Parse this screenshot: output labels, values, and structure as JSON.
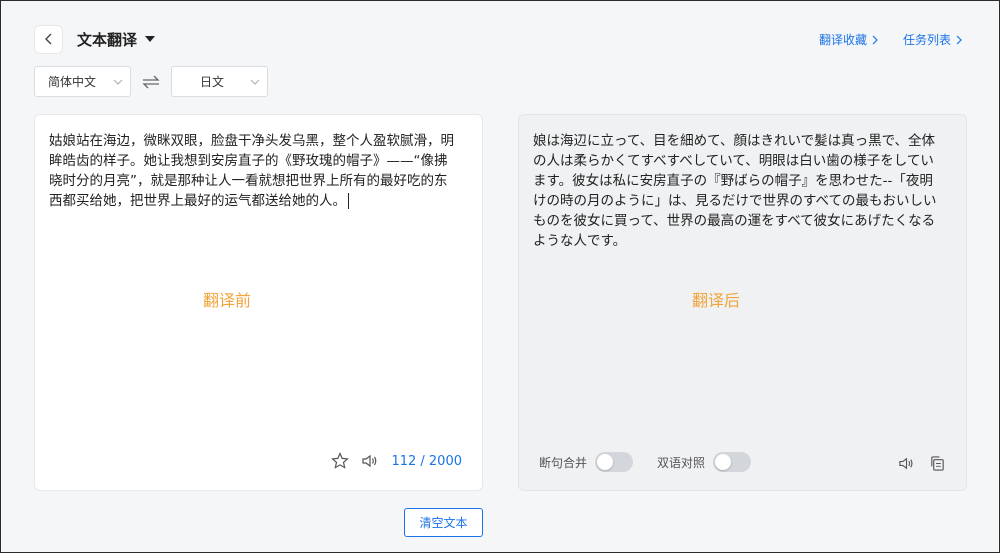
{
  "header": {
    "title": "文本翻译"
  },
  "top_links": {
    "favorites": "翻译收藏",
    "tasks": "任务列表"
  },
  "languages": {
    "source": "简体中文",
    "target": "日文"
  },
  "source_panel": {
    "text": "姑娘站在海边，微眯双眼，脸盘干净头发乌黑，整个人盈软腻滑，明眸皓齿的样子。她让我想到安房直子的《野玫瑰的帽子》——“像拂晓时分的月亮”，就是那种让人一看就想把世界上所有的最好吃的东西都买给她，把世界上最好的运气都送给她的人。",
    "hint": "翻译前",
    "char_count": "112 / 2000"
  },
  "target_panel": {
    "text": "娘は海辺に立って、目を細めて、顔はきれいで髪は真っ黒で、全体の人は柔らかくてすべすべしていて、明眼は白い歯の様子をしています。彼女は私に安房直子の『野ばらの帽子』を思わせた--「夜明けの時の月のように」は、見るだけで世界のすべての最もおいしいものを彼女に買って、世界の最高の運をすべて彼女にあげたくなるような人です。",
    "hint": "翻译后",
    "toggle_merge_label": "断句合并",
    "toggle_compare_label": "双语对照"
  },
  "actions": {
    "clear": "清空文本"
  },
  "colors": {
    "accent": "#1a73e8",
    "hint": "#f0a43a"
  },
  "icons": [
    "chevron-left-icon",
    "caret-down-icon",
    "chevron-right-icon",
    "swap-icon",
    "star-icon",
    "speaker-icon",
    "copy-icon"
  ]
}
